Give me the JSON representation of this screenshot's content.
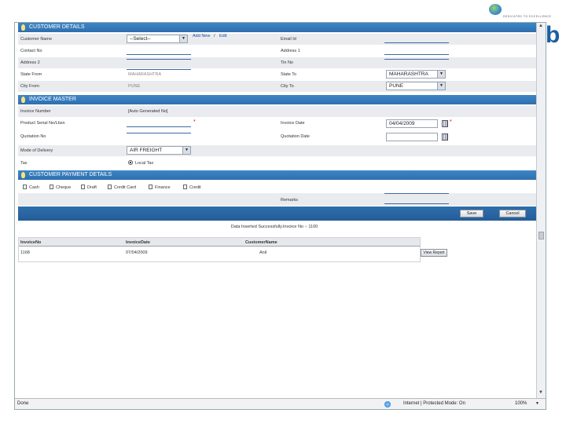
{
  "window": {
    "status": "Done",
    "zone": "Internet | Protected Mode: On",
    "zoom": "100%"
  },
  "logo": {
    "letter": "b",
    "tagline": "DEDICATED TO EXCELLENCE"
  },
  "sections": {
    "customer": "CUSTOMER DETAILS",
    "invoice": "INVOICE MASTER",
    "payment": "CUSTOMER PAYMENT DETAILS"
  },
  "customer": {
    "name_label": "Customer Name",
    "name_value": "--Select--",
    "add_new": "Add New",
    "sep": "/",
    "edit": "Edit",
    "email_label": "Email Id",
    "contact_label": "Contact No",
    "address1_label": "Address 1",
    "address2_label": "Address 2",
    "tin_label": "Tin No",
    "state_from_label": "State From",
    "state_from_value": "MAHARASHTRA",
    "state_to_label": "State To",
    "state_to_value": "MAHARASHTRA",
    "city_from_label": "City From",
    "city_from_value": "PUNE",
    "city_to_label": "City To",
    "city_to_value": "PUNE"
  },
  "invoice": {
    "number_label": "Invoice Number",
    "number_value": "[Auto Generated No]",
    "product_label": "Product Serial No/Lbsn",
    "req": "*",
    "date_label": "Invoice Date",
    "date_value": "04/04/2009",
    "quotation_no_label": "Quotation No",
    "quotation_date_label": "Quotation Date",
    "delivery_label": "Mode of Delivery",
    "delivery_value": "AIR FREIGHT",
    "tax_label": "Tax",
    "tax_value": "Local Tax"
  },
  "payment": {
    "options": [
      "Cash",
      "Cheque",
      "Draft",
      "Credit Card",
      "Finance",
      "Credit"
    ],
    "remarks_label": "Remarks"
  },
  "actions": {
    "save": "Save",
    "cancel": "Cancel"
  },
  "message": "Data Inserted Successfully.Invoice No :- 1100",
  "grid": {
    "headers": [
      "InvoiceNo",
      "InvoiceDate",
      "CustomerName"
    ],
    "rows": [
      {
        "no": "1168",
        "date": "07/04/2009",
        "name": "Anil"
      }
    ],
    "view_report": "View Report"
  }
}
